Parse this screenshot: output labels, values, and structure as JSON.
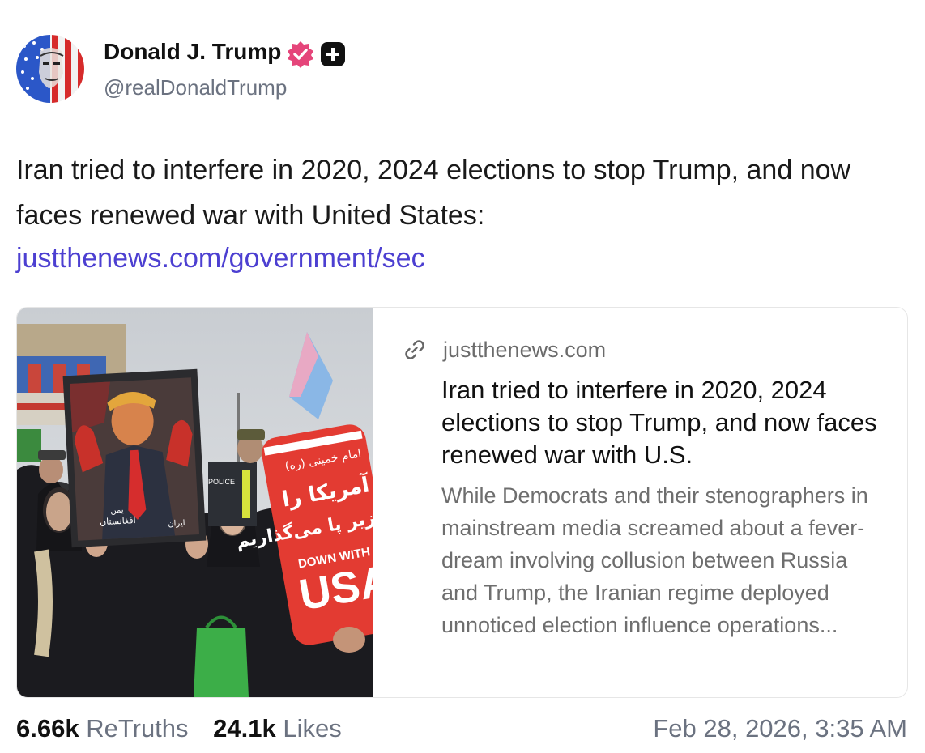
{
  "author": {
    "display_name": "Donald J. Trump",
    "handle": "@realDonaldTrump",
    "avatar_icon": "portrait-avatar",
    "verified_icon": "verified-badge-icon",
    "plus_icon": "plus-badge-icon"
  },
  "post": {
    "text": "Iran tried to interfere in 2020, 2024 elections to stop Trump, and now faces renewed war with United States:",
    "link": "justthenews.com/government/sec"
  },
  "card": {
    "domain": "justthenews.com",
    "title": "Iran tried to interfere in 2020, 2024 elections to stop Trump, and now faces renewed war with U.S.",
    "description": "While Democrats and their stenographers in mainstream media screamed about a fever-dream involving collusion between Russia and Trump, the Iranian regime deployed unnoticed election influence operations...",
    "image_signs": {
      "sign_line1": "امام خمینی (ره)",
      "sign_line2": "آمریکا را",
      "sign_line3": "زیر پا می‌گذاریم",
      "sign_banner": "DOWN WITH",
      "sign_big": "USA",
      "poster_left": "افغانستان",
      "poster_mid": "یمن",
      "poster_right": "ایران",
      "police": "POLICE"
    }
  },
  "stats": {
    "retruths_count": "6.66k",
    "retruths_label": "ReTruths",
    "likes_count": "24.1k",
    "likes_label": "Likes"
  },
  "timestamp": "Feb 28, 2026, 3:35 AM",
  "colors": {
    "link": "#4c3fd1",
    "verified": "#e5457a",
    "muted": "#6b7280"
  }
}
